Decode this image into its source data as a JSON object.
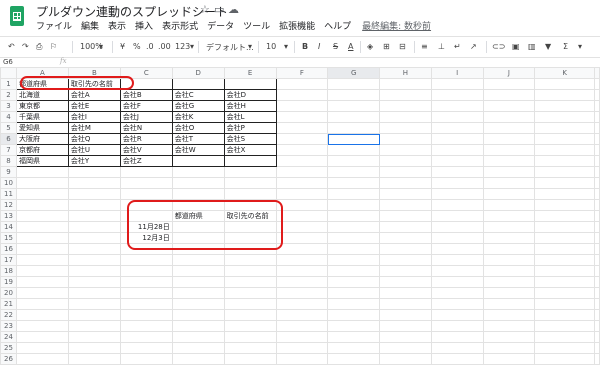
{
  "title": {
    "doc_name": "プルダウン連動のスプレッドシート",
    "star_icon": "star-icon",
    "folder_icon": "folder-icon",
    "cloud_icon": "cloud-icon"
  },
  "menu": {
    "items": [
      "ファイル",
      "編集",
      "表示",
      "挿入",
      "表示形式",
      "データ",
      "ツール",
      "拡張機能",
      "ヘルプ"
    ],
    "last_edit": "最終編集: 数秒前"
  },
  "toolbar": {
    "zoom": "100%",
    "currency": "¥",
    "percent": "%",
    "dec_less": ".0",
    "dec_more": ".00",
    "format_more": "123",
    "font": "デフォルト...",
    "font_size": "10",
    "bold": "B",
    "italic": "I",
    "strike": "S",
    "text_color": "A"
  },
  "formula": {
    "cell_ref": "G6",
    "fx": "fx",
    "value": ""
  },
  "columns": [
    "A",
    "B",
    "C",
    "D",
    "E",
    "F",
    "G",
    "H",
    "I",
    "J",
    "K"
  ],
  "rows": [
    [
      "都道府県",
      "取引先の名前",
      "",
      "",
      "",
      "",
      "",
      "",
      "",
      "",
      ""
    ],
    [
      "北海道",
      "会社A",
      "会社B",
      "会社C",
      "会社D",
      "",
      "",
      "",
      "",
      "",
      ""
    ],
    [
      "東京都",
      "会社E",
      "会社F",
      "会社G",
      "会社H",
      "",
      "",
      "",
      "",
      "",
      ""
    ],
    [
      "千葉県",
      "会社I",
      "会社J",
      "会社K",
      "会社L",
      "",
      "",
      "",
      "",
      "",
      ""
    ],
    [
      "愛知県",
      "会社M",
      "会社N",
      "会社O",
      "会社P",
      "",
      "",
      "",
      "",
      "",
      ""
    ],
    [
      "大阪府",
      "会社Q",
      "会社R",
      "会社T",
      "会社S",
      "",
      "",
      "",
      "",
      "",
      ""
    ],
    [
      "京都府",
      "会社U",
      "会社V",
      "会社W",
      "会社X",
      "",
      "",
      "",
      "",
      "",
      ""
    ],
    [
      "福岡県",
      "会社Y",
      "会社Z",
      "",
      "",
      "",
      "",
      "",
      "",
      "",
      ""
    ],
    [
      "",
      "",
      "",
      "",
      "",
      "",
      "",
      "",
      "",
      "",
      ""
    ],
    [
      "",
      "",
      "",
      "",
      "",
      "",
      "",
      "",
      "",
      "",
      ""
    ],
    [
      "",
      "",
      "",
      "",
      "",
      "",
      "",
      "",
      "",
      "",
      ""
    ],
    [
      "",
      "",
      "",
      "",
      "",
      "",
      "",
      "",
      "",
      "",
      ""
    ],
    [
      "",
      "",
      "",
      "都道府県",
      "取引先の名前",
      "",
      "",
      "",
      "",
      "",
      ""
    ],
    [
      "",
      "",
      "11月28日",
      "",
      "",
      "",
      "",
      "",
      "",
      "",
      ""
    ],
    [
      "",
      "",
      "12月3日",
      "",
      "",
      "",
      "",
      "",
      "",
      "",
      ""
    ],
    [
      "",
      "",
      "",
      "",
      "",
      "",
      "",
      "",
      "",
      "",
      ""
    ],
    [
      "",
      "",
      "",
      "",
      "",
      "",
      "",
      "",
      "",
      "",
      ""
    ],
    [
      "",
      "",
      "",
      "",
      "",
      "",
      "",
      "",
      "",
      "",
      ""
    ],
    [
      "",
      "",
      "",
      "",
      "",
      "",
      "",
      "",
      "",
      "",
      ""
    ],
    [
      "",
      "",
      "",
      "",
      "",
      "",
      "",
      "",
      "",
      "",
      ""
    ],
    [
      "",
      "",
      "",
      "",
      "",
      "",
      "",
      "",
      "",
      "",
      ""
    ],
    [
      "",
      "",
      "",
      "",
      "",
      "",
      "",
      "",
      "",
      "",
      ""
    ],
    [
      "",
      "",
      "",
      "",
      "",
      "",
      "",
      "",
      "",
      "",
      ""
    ],
    [
      "",
      "",
      "",
      "",
      "",
      "",
      "",
      "",
      "",
      "",
      ""
    ],
    [
      "",
      "",
      "",
      "",
      "",
      "",
      "",
      "",
      "",
      "",
      ""
    ],
    [
      "",
      "",
      "",
      "",
      "",
      "",
      "",
      "",
      "",
      "",
      ""
    ],
    [
      "",
      "",
      "",
      "",
      "",
      "",
      "",
      "",
      "",
      "",
      ""
    ]
  ],
  "selected_cell": "G6",
  "colors": {
    "annotation": "#e01b1b",
    "selection": "#1a73e8",
    "logo": "#1fa463"
  }
}
